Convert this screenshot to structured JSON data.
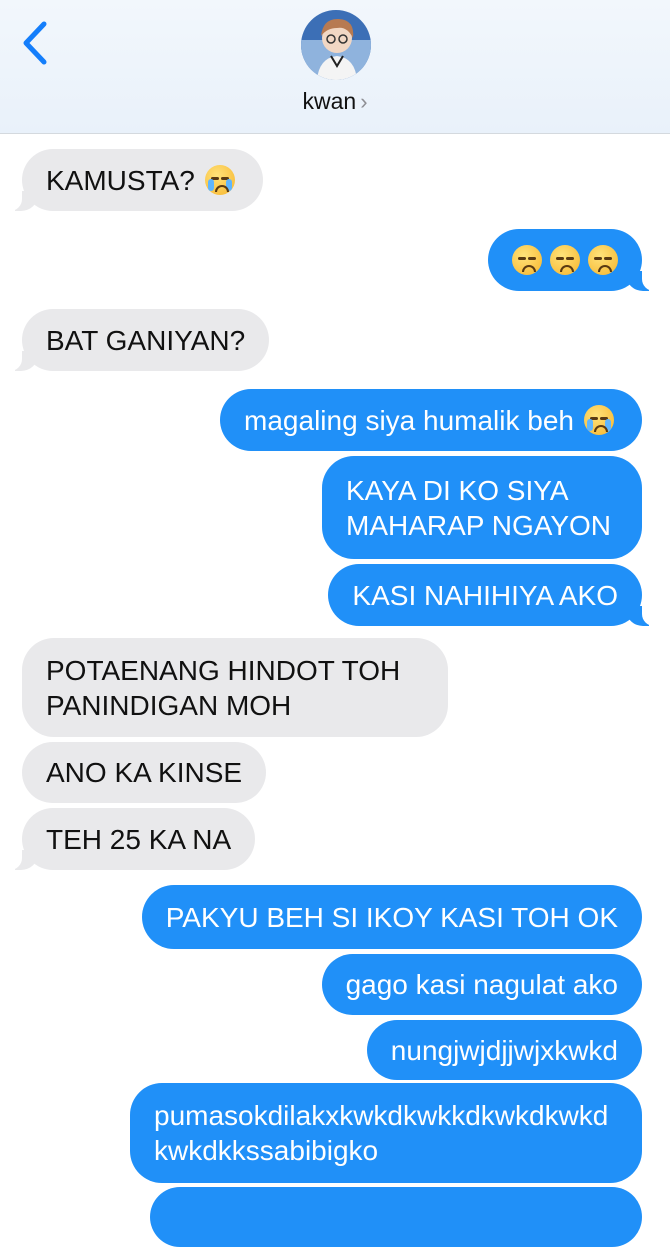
{
  "header": {
    "contact_name": "kwan",
    "back_icon": "chevron-left-icon",
    "chevron": "›"
  },
  "colors": {
    "outgoing": "#2090f8",
    "incoming": "#e9e9eb",
    "accent": "#147efb"
  },
  "messages": [
    {
      "dir": "in",
      "text": "KAMUSTA?",
      "emoji": "loudly-crying-face-icon"
    },
    {
      "dir": "out",
      "text": "",
      "emoji": "pleading-face-icon x3"
    },
    {
      "dir": "in",
      "text": "BAT GANIYAN?"
    },
    {
      "dir": "out",
      "text": "magaling siya humalik beh",
      "emoji": "loudly-crying-face-icon"
    },
    {
      "dir": "out",
      "text": "KAYA DI KO SIYA MAHARAP NGAYON"
    },
    {
      "dir": "out",
      "text": "KASI NAHIHIYA AKO"
    },
    {
      "dir": "in",
      "text": "POTAENANG HINDOT TOH PANINDIGAN MOH"
    },
    {
      "dir": "in",
      "text": "ANO KA KINSE"
    },
    {
      "dir": "in",
      "text": "TEH 25 KA NA"
    },
    {
      "dir": "out",
      "text": "PAKYU BEH SI IKOY KASI TOH OK"
    },
    {
      "dir": "out",
      "text": "gago kasi nagulat ako"
    },
    {
      "dir": "out",
      "text": "nungjwjdjjwjxkwkd"
    },
    {
      "dir": "out",
      "text": "pumasokdilakxkwkdkwkkdkwkdkwkdkwkdkkssabibigko"
    }
  ]
}
